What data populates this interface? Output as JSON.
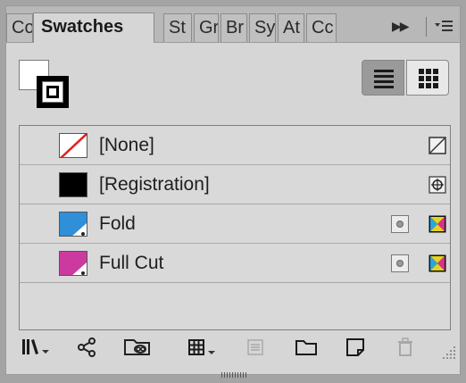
{
  "tabs": [
    {
      "label": "Co",
      "active": false
    },
    {
      "label": "Swatches",
      "active": true
    },
    {
      "label": "St",
      "active": false
    },
    {
      "label": "Gr",
      "active": false
    },
    {
      "label": "Br",
      "active": false
    },
    {
      "label": "Sy",
      "active": false
    },
    {
      "label": "At",
      "active": false
    },
    {
      "label": "Cc",
      "active": false
    }
  ],
  "tabbar": {
    "more_glyph": "▶▶",
    "menu_glyph": "☰"
  },
  "swatches": [
    {
      "name": "[None]",
      "chip": "none",
      "color": "#ffffff",
      "right_icon": "none-swatch-icon",
      "spot": false
    },
    {
      "name": "[Registration]",
      "chip": "solid",
      "color": "#000000",
      "right_icon": "registration-icon",
      "spot": false
    },
    {
      "name": "Fold",
      "chip": "solid",
      "color": "#2f8fd8",
      "right_icon": "cmyk-icon",
      "spot": true
    },
    {
      "name": "Full Cut",
      "chip": "solid",
      "color": "#cc3aa0",
      "right_icon": "cmyk-icon",
      "spot": true
    }
  ],
  "view": {
    "selected": "list"
  },
  "toolbar": {
    "icons": [
      "libraries-icon",
      "share-icon",
      "cloud-link-icon",
      "swatch-views-icon",
      "swatch-options-icon",
      "folder-icon",
      "new-swatch-icon",
      "delete-icon"
    ]
  }
}
